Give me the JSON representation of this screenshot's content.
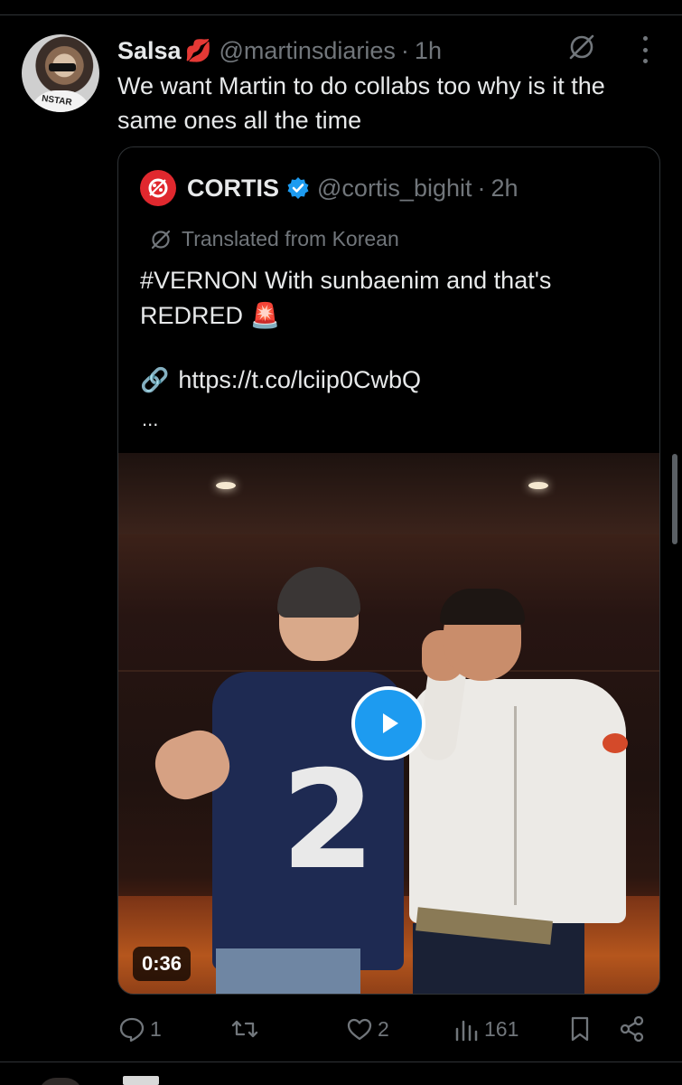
{
  "post": {
    "display_name": "Salsa",
    "name_emoji": "💋",
    "handle": "@martinsdiaries",
    "separator": "·",
    "time": "1h",
    "text": "We want Martin to do collabs too why is it the same ones all the time",
    "avatar_shirt_text": "NSTAR"
  },
  "quoted_post": {
    "display_name": "CORTIS",
    "handle": "@cortis_bighit",
    "separator": "·",
    "time": "2h",
    "translated_label": "Translated from Korean",
    "text": "#VERNON With sunbaenim and that's REDRED 🚨",
    "link_emoji": "🔗",
    "link": "https://t.co/lciip0CwbQ",
    "ellipsis": "...",
    "video_duration": "0:36",
    "media_number": "2"
  },
  "actions": {
    "replies": "1",
    "reposts": "",
    "likes": "2",
    "views": "161"
  },
  "icons": [
    "grok-icon",
    "more-icon",
    "verified-icon",
    "translate-icon",
    "play-icon",
    "reply-icon",
    "repost-icon",
    "like-icon",
    "views-icon",
    "bookmark-icon",
    "share-icon"
  ],
  "colors": {
    "background": "#000000",
    "text": "#e7e9ea",
    "secondary_text": "#71767b",
    "accent": "#1d9bf0",
    "border": "#2f3336"
  }
}
